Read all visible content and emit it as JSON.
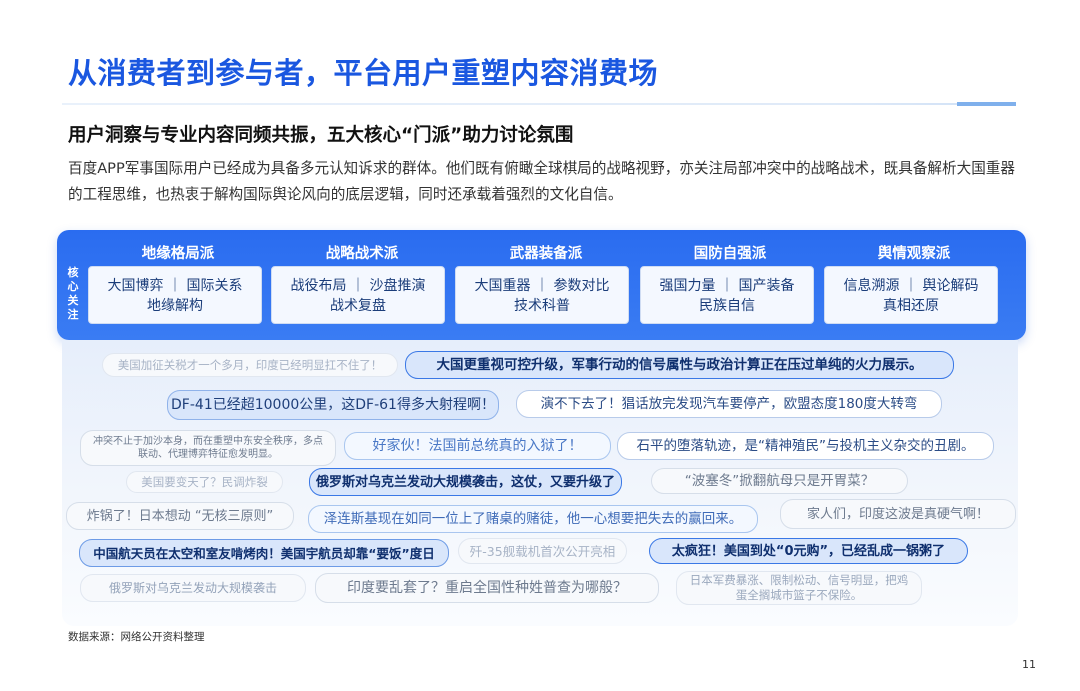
{
  "title": "从消费者到参与者，平台用户重塑内容消费场",
  "subtitle": "用户洞察与专业内容同频共振，五大核心“门派”助力讨论氛围",
  "description": "百度APP军事国际用户已经成为具备多元认知诉求的群体。他们既有俯瞰全球棋局的战略视野，亦关注局部冲突中的战略战术，既具备解析大国重器的工程思维，也热衷于解构国际舆论风向的底层逻辑，同时还承载着强烈的文化自信。",
  "panel": {
    "side_label": [
      "核",
      "心",
      "关",
      "注"
    ],
    "sections": [
      {
        "name": "地缘格局派",
        "line1": "大国博弈 ｜ 国际关系",
        "line2": "地缘解构"
      },
      {
        "name": "战略战术派",
        "line1": "战役布局 ｜ 沙盘推演",
        "line2": "战术复盘"
      },
      {
        "name": "武器装备派",
        "line1": "大国重器 ｜ 参数对比",
        "line2": "技术科普"
      },
      {
        "name": "国防自强派",
        "line1": "强国力量 ｜ 国产装备",
        "line2": "民族自信"
      },
      {
        "name": "舆情观察派",
        "line1": "信息溯源 ｜ 舆论解码",
        "line2": "真相还原"
      }
    ]
  },
  "comments": [
    "美国加征关税才一个多月，印度已经明显扛不住了！",
    "大国更重视可控升级，军事行动的信号属性与政治计算正在压过单纯的火力展示。",
    "DF-41已经超10000公里，这DF-61得多大射程啊！",
    "演不下去了！猖话放完发现汽车要停产，欧盟态度180度大转弯",
    "冲突不止于加沙本身，而在重塑中东安全秩序，多点联动、代理博弈特征愈发明显。",
    "好家伙！法国前总统真的入狱了！",
    "石平的堕落轨迹，是“精神殖民”与投机主义杂交的丑剧。",
    "美国要变天了？民调炸裂",
    "俄罗斯对乌克兰发动大规模袭击，这仗，又要升级了",
    "“波塞冬”掀翻航母只是开胃菜？",
    "炸锅了！日本想动 “无核三原则”",
    "泽连斯基现在如同一位上了赌桌的赌徒，他一心想要把失去的赢回来。",
    "家人们，印度这波是真硬气啊！",
    "中国航天员在太空和室友啃烤肉！美国宇航员却靠“要饭”度日",
    "歼-35舰载机首次公开亮相",
    "太疯狂！美国到处“0元购”，已经乱成一锅粥了",
    "俄罗斯对乌克兰发动大规模袭击",
    "印度要乱套了？重启全国性种姓普查为哪般？",
    "日本军费暴涨、限制松动、信号明显，把鸡蛋全搁城市篮子不保险。"
  ],
  "source": "数据来源：网络公开资料整理",
  "page_number": "11"
}
